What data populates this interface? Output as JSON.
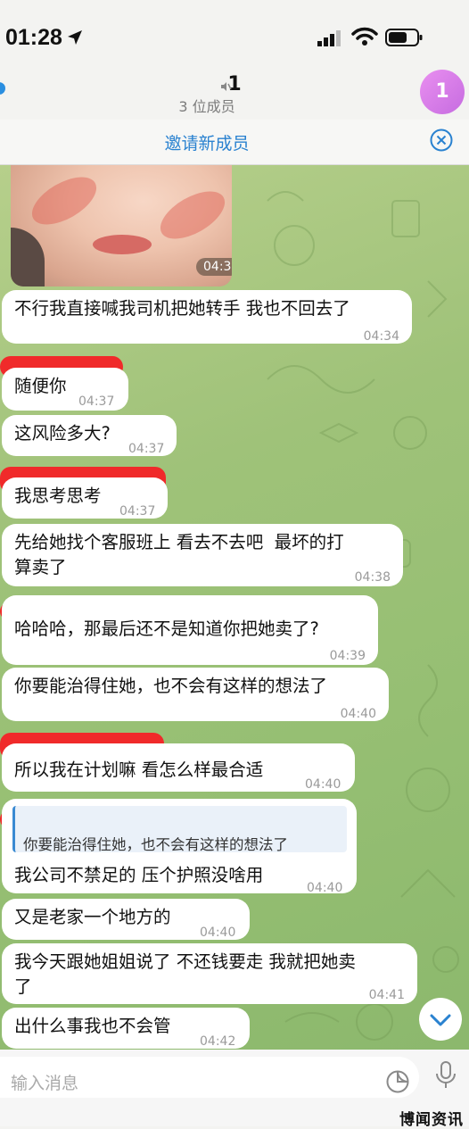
{
  "status_bar": {
    "time": "01:28"
  },
  "header": {
    "title": "1",
    "subtitle": "3 位成员",
    "avatar_initial": "1",
    "avatar_color": "#d77be8"
  },
  "banner": {
    "invite_label": "邀请新成员"
  },
  "photo_message": {
    "time": "04:34"
  },
  "messages": [
    {
      "text": "不行我直接喊我司机把她转手 我也不回去了",
      "time": "04:34"
    },
    {
      "text": "随便你",
      "time": "04:37"
    },
    {
      "text": "这风险多大?",
      "time": "04:37"
    },
    {
      "text": "我思考思考",
      "time": "04:37"
    },
    {
      "text": "先给她找个客服班上 看去不去吧  最坏的打\n算卖了",
      "time": "04:38"
    },
    {
      "text": "哈哈哈，那最后还不是知道你把她卖了?",
      "time": "04:39"
    },
    {
      "text": "你要能治得住她，也不会有这样的想法了",
      "time": "04:40"
    },
    {
      "text": "所以我在计划嘛 看怎么样最合适",
      "time": "04:40"
    },
    {
      "text": "我公司不禁足的 压个护照没啥用",
      "time": "04:40",
      "quote": "你要能治得住她，也不会有这样的想法了"
    },
    {
      "text": "又是老家一个地方的",
      "time": "04:40"
    },
    {
      "text": "我今天跟她姐姐说了 不还钱要走 我就把她卖\n了",
      "time": "04:41"
    },
    {
      "text": "出什么事我也不会管",
      "time": "04:42"
    }
  ],
  "input": {
    "placeholder": "输入消息"
  },
  "watermark": "博闻资讯",
  "colors": {
    "accent": "#2a82d0",
    "redaction": "#f02a2a",
    "chat_background": "#9fc279"
  }
}
